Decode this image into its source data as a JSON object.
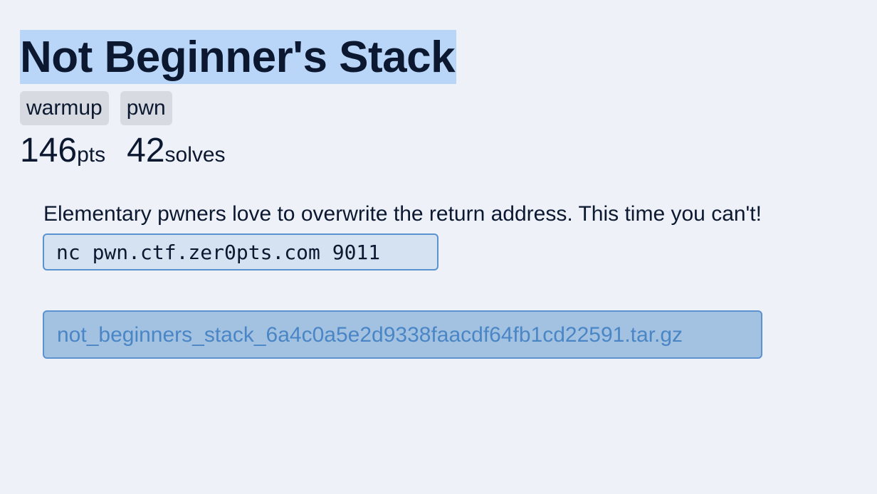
{
  "challenge": {
    "title": "Not Beginner's Stack",
    "tags": [
      "warmup",
      "pwn"
    ],
    "points": "146",
    "points_unit": "pts",
    "solves": "42",
    "solves_unit": "solves",
    "description": "Elementary pwners love to overwrite the return address. This time you can't!",
    "command": "nc pwn.ctf.zer0pts.com 9011",
    "attachment": "not_beginners_stack_6a4c0a5e2d9338faacdf64fb1cd22591.tar.gz"
  },
  "colors": {
    "background": "#eef1f7",
    "title_highlight": "#b9d6f8",
    "tag_background": "#d7dbe1",
    "command_background": "#d5e2f1",
    "accent_border": "#5a93cf",
    "link_text": "#4a86c5"
  }
}
